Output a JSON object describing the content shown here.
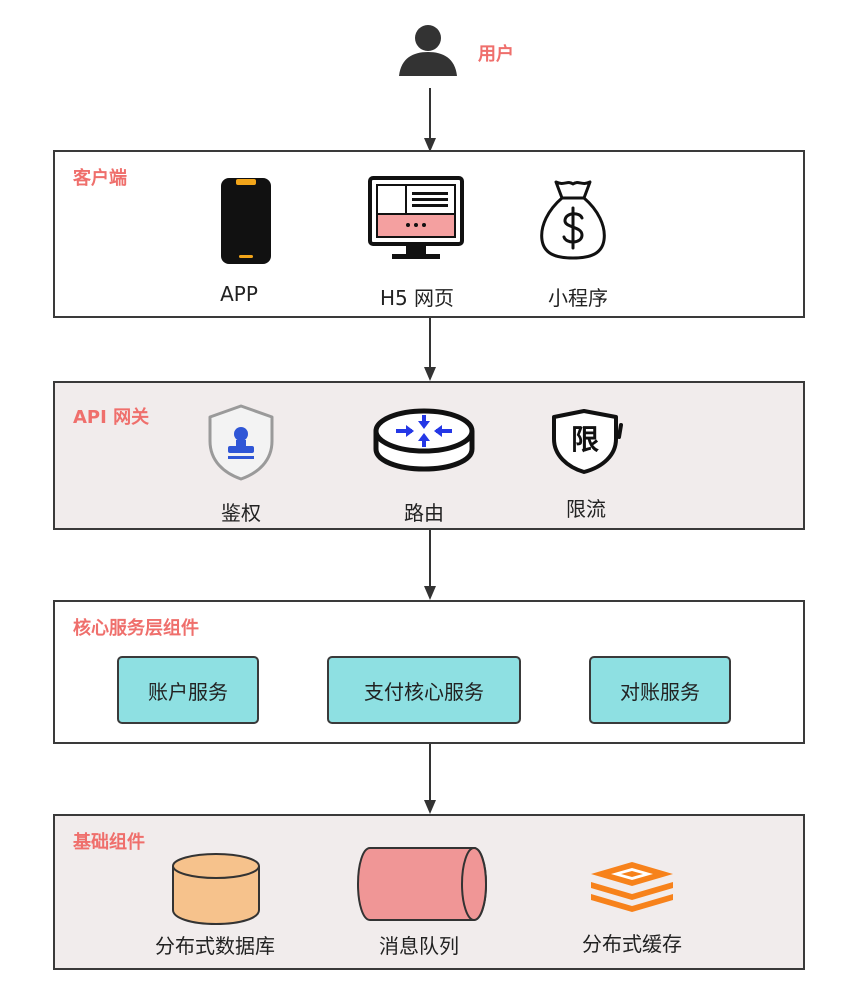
{
  "user": {
    "label": "用户",
    "icon": "user-icon"
  },
  "client_layer": {
    "title": "客户端",
    "items": [
      {
        "label": "APP",
        "icon": "smartphone-icon"
      },
      {
        "label": "H5 网页",
        "icon": "monitor-icon"
      },
      {
        "label": "小程序",
        "icon": "money-bag-icon"
      }
    ]
  },
  "gateway_layer": {
    "title": "API 网关",
    "items": [
      {
        "label": "鉴权",
        "icon": "shield-stamp-icon"
      },
      {
        "label": "路由",
        "icon": "router-icon"
      },
      {
        "label": "限流",
        "icon": "shield-limit-icon",
        "glyph": "限"
      }
    ]
  },
  "core_layer": {
    "title": "核心服务层组件",
    "services": [
      "账户服务",
      "支付核心服务",
      "对账服务"
    ]
  },
  "base_layer": {
    "title": "基础组件",
    "items": [
      {
        "label": "分布式数据库",
        "icon": "database-icon"
      },
      {
        "label": "消息队列",
        "icon": "message-queue-icon"
      },
      {
        "label": "分布式缓存",
        "icon": "cache-stack-icon"
      }
    ]
  },
  "colors": {
    "accent_title": "#ef6f6c",
    "service_fill": "#8ee0e2",
    "gray_layer": "#f1ecec",
    "database_fill": "#f6c28c",
    "queue_fill": "#f09696",
    "cache_fill": "#f7821b"
  }
}
